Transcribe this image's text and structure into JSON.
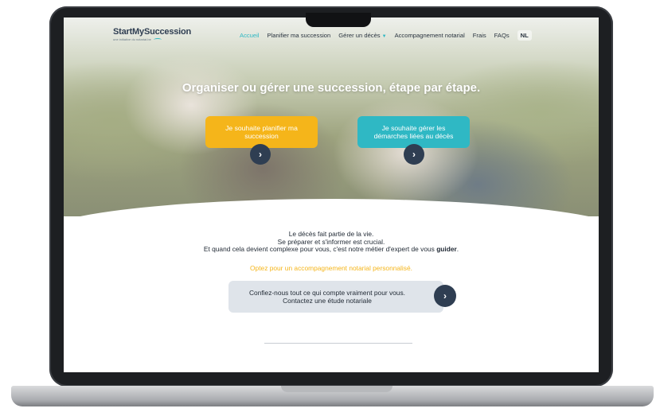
{
  "logo": {
    "name": "StartMySuccession",
    "tagline": "une initiative du notariat.be"
  },
  "nav": {
    "items": [
      {
        "label": "Accueil",
        "active": true
      },
      {
        "label": "Planifier ma succession"
      },
      {
        "label": "Gérer un décès"
      },
      {
        "label": "Accompagnement notarial"
      },
      {
        "label": "Frais"
      },
      {
        "label": "FAQs"
      },
      {
        "label": "NL"
      }
    ]
  },
  "hero": {
    "title": "Organiser ou gérer une succession, étape par étape.",
    "cta_plan": "Je souhaite planifier ma succession",
    "cta_manage": "Je souhaite gérer les démarches liées au décès"
  },
  "intro": {
    "line1": "Le décès fait partie de la vie.",
    "line2": "Se préparer et s'informer est crucial.",
    "line3_prefix": "Et quand cela devient complexe pour vous, c'est notre métier d'expert de vous",
    "line3_bold": "guider",
    "line3_suffix": "."
  },
  "highlight": "Optez pour un accompagnement notarial personnalisé.",
  "contact": {
    "line1": "Confiez-nous tout ce qui compte vraiment pour vous.",
    "line2": "Contactez une étude notariale"
  },
  "colors": {
    "accent_teal": "#2fb8c4",
    "accent_yellow": "#f5b51a",
    "navy": "#2f3e52"
  },
  "icons": {
    "arrow": "chevron-right-icon",
    "dropdown": "chevron-down-icon"
  }
}
